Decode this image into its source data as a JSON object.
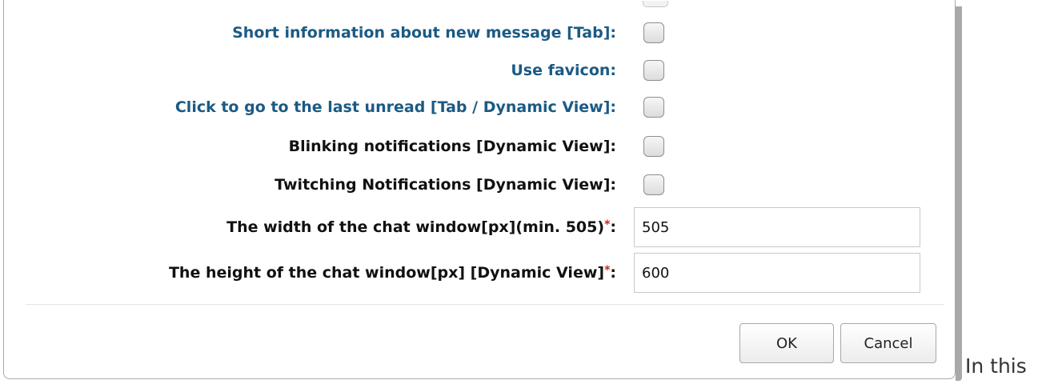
{
  "form": {
    "rows": [
      {
        "label": "Short information about new message [Tab]:",
        "type": "checkbox",
        "checked": false
      },
      {
        "label": "Use favicon:",
        "type": "checkbox",
        "checked": false
      },
      {
        "label": "Click to go to the last unread [Tab / Dynamic View]:",
        "type": "checkbox",
        "checked": false
      },
      {
        "label": "Blinking notifications [Dynamic View]:",
        "type": "checkbox",
        "checked": false
      },
      {
        "label": "Twitching Notifications [Dynamic View]:",
        "type": "checkbox",
        "checked": false
      }
    ],
    "width_field": {
      "label": "The width of the chat window[px](min. 505)",
      "required_mark": "*",
      "suffix": ":",
      "value": "505"
    },
    "height_field": {
      "label": "The height of the chat window[px] [Dynamic View]",
      "required_mark": "*",
      "suffix": ":",
      "value": "600"
    }
  },
  "buttons": {
    "ok_label": "OK",
    "cancel_label": "Cancel"
  },
  "trailing_text": "In this",
  "colors": {
    "link_label": "#1b5a84",
    "plain_label": "#111111",
    "required_mark": "#cc2222"
  }
}
